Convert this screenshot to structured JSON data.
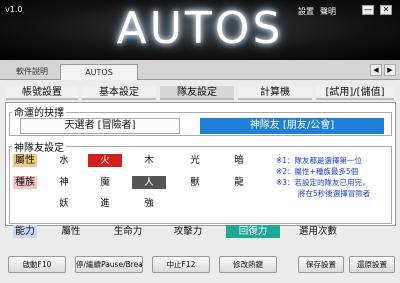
{
  "header": {
    "version": "v1.0",
    "logo": "AUTOS",
    "settings_label": "設置",
    "help_label": "聲明",
    "minimize_label": "—",
    "close_label": "✕"
  },
  "top_tabs": [
    {
      "label": "軟件說明"
    },
    {
      "label": "AUTOS"
    }
  ],
  "nav": {
    "prev": "◀",
    "next": "▶"
  },
  "sub_tabs": [
    {
      "label": "帳號設置"
    },
    {
      "label": "基本設定"
    },
    {
      "label": "隊友設定"
    },
    {
      "label": "計算機"
    },
    {
      "label": "[試用]/[儲值]"
    }
  ],
  "choice_group": {
    "title": "命運的抉擇",
    "option_a": "天選者 [冒險者]",
    "option_b": "神隊友 [朋友/公會]"
  },
  "teammate_group": {
    "title": "神隊友設定",
    "attribute_label": "屬性",
    "attributes": [
      "水",
      "火",
      "木",
      "光",
      "暗"
    ],
    "race_label": "種族",
    "races_row1": [
      "神",
      "魔",
      "人",
      "獸",
      "龍"
    ],
    "races_row2": [
      "妖",
      "進",
      "強"
    ],
    "ability_label": "能力",
    "abilities": [
      "屬性",
      "生命力",
      "攻擊力",
      "回復力"
    ],
    "use_count_label": "選用次數",
    "notes": [
      "※1：隊友都是選擇第一位",
      "※2：屬性+種族最多5個",
      "※3：若設定的隊友已用完，",
      "將在5秒後選擇冒險者"
    ]
  },
  "buttons": {
    "start": "啟動F10",
    "pause": "停/繼續Pause/Break",
    "stop": "中止F12",
    "edit": "修改熱鍵",
    "save": "保存設置",
    "restore": "還原設置"
  },
  "colors": {
    "selected_red": "#d41e1e",
    "selected_gray": "#555555",
    "selected_teal": "#1fa896",
    "accent_blue": "#1e7fd6",
    "attr_label_bg": "#f2c886",
    "race_label_bg": "#f6c6c6",
    "ability_label_bg": "#c9d8f5"
  }
}
